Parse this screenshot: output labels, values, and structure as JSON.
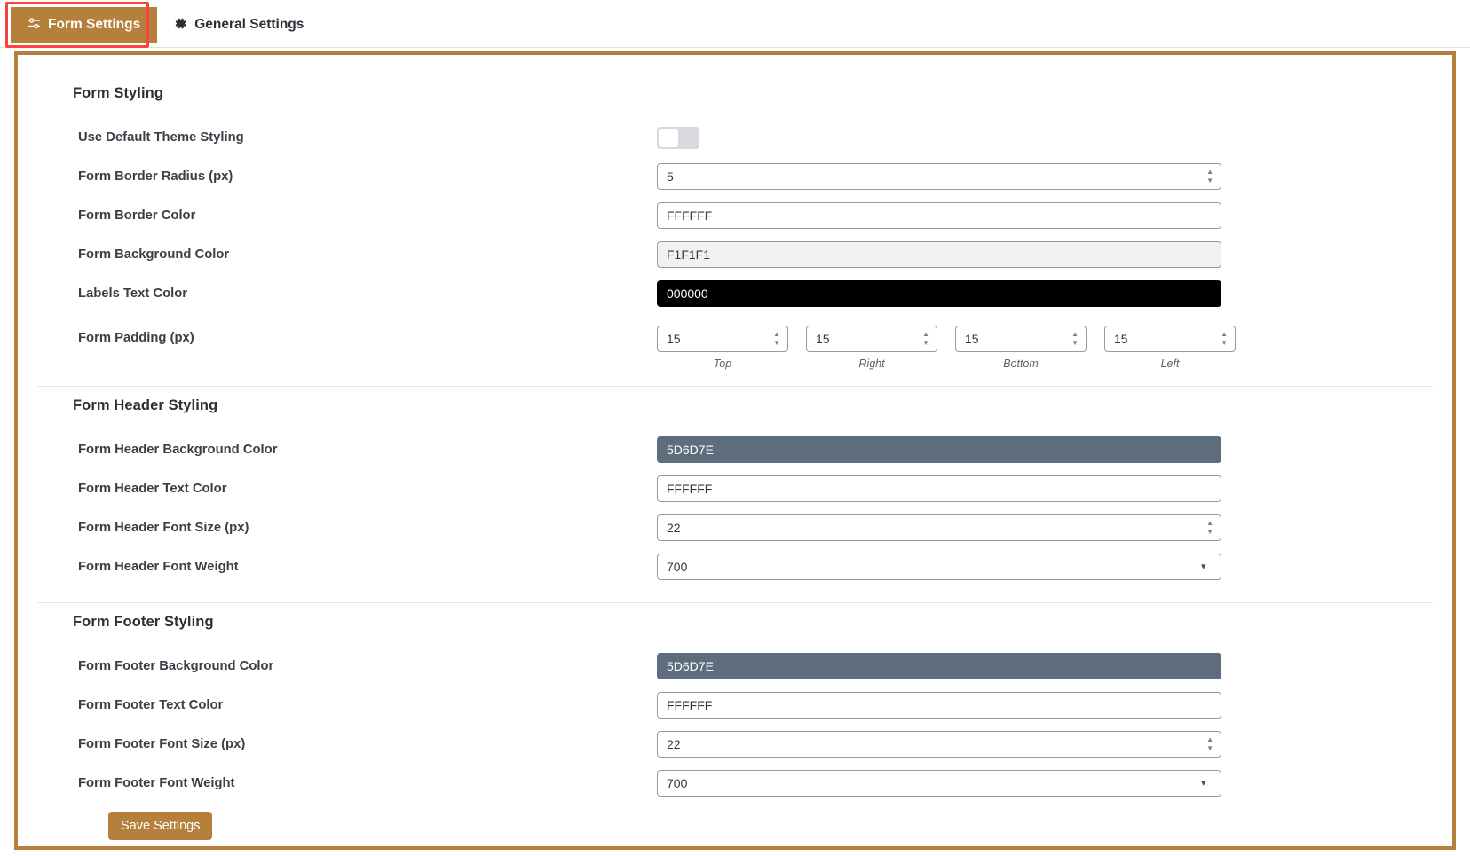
{
  "tabs": [
    {
      "label": "Form Settings",
      "icon": "sliders-icon",
      "active": true
    },
    {
      "label": "General Settings",
      "icon": "gear-icon",
      "active": false
    }
  ],
  "theme": {
    "accent": "#B5803B",
    "highlight": "#F8443F",
    "slate": "#5D6D7E"
  },
  "sections": [
    {
      "title": "Form Styling",
      "rows": [
        {
          "label": "Use Default Theme Styling",
          "type": "toggle",
          "value": "off"
        },
        {
          "label": "Form Border Radius (px)",
          "type": "number",
          "value": "5"
        },
        {
          "label": "Form Border Color",
          "type": "color",
          "value": "FFFFFF",
          "swatch": "#FFFFFF",
          "text": "#33373D"
        },
        {
          "label": "Form Background Color",
          "type": "color",
          "value": "F1F1F1",
          "swatch": "#F1F1F1",
          "text": "#33373D"
        },
        {
          "label": "Labels Text Color",
          "type": "color",
          "value": "000000",
          "swatch": "#000000",
          "text": "#FFFFFF"
        },
        {
          "label": "Form Padding (px)",
          "type": "padding",
          "cells": [
            {
              "value": "15",
              "caption": "Top"
            },
            {
              "value": "15",
              "caption": "Right"
            },
            {
              "value": "15",
              "caption": "Bottom"
            },
            {
              "value": "15",
              "caption": "Left"
            }
          ]
        }
      ]
    },
    {
      "title": "Form Header Styling",
      "rows": [
        {
          "label": "Form Header Background Color",
          "type": "color",
          "value": "5D6D7E",
          "swatch": "#5D6D7E",
          "text": "#FFFFFF"
        },
        {
          "label": "Form Header Text Color",
          "type": "color",
          "value": "FFFFFF",
          "swatch": "#FFFFFF",
          "text": "#33373D"
        },
        {
          "label": "Form Header Font Size (px)",
          "type": "number",
          "value": "22"
        },
        {
          "label": "Form Header Font Weight",
          "type": "select",
          "value": "700"
        }
      ]
    },
    {
      "title": "Form Footer Styling",
      "rows": [
        {
          "label": "Form Footer Background Color",
          "type": "color",
          "value": "5D6D7E",
          "swatch": "#5D6D7E",
          "text": "#FFFFFF"
        },
        {
          "label": "Form Footer Text Color",
          "type": "color",
          "value": "FFFFFF",
          "swatch": "#FFFFFF",
          "text": "#33373D"
        },
        {
          "label": "Form Footer Font Size (px)",
          "type": "number",
          "value": "22"
        },
        {
          "label": "Form Footer Font Weight",
          "type": "select",
          "value": "700"
        }
      ]
    }
  ],
  "footer": {
    "save_label": "Save Settings"
  }
}
